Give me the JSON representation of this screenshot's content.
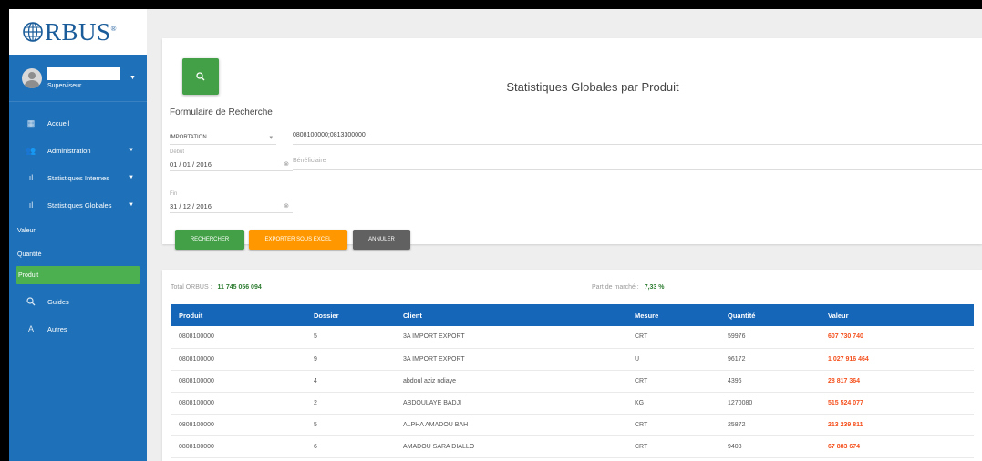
{
  "app": {
    "logo": "RBUS",
    "logo_mark": "®"
  },
  "user": {
    "role": "Superviseur"
  },
  "sidebar": {
    "items": [
      {
        "label": "Accueil"
      },
      {
        "label": "Administration"
      },
      {
        "label": "Statistiques Internes"
      },
      {
        "label": "Statistiques Globales"
      }
    ],
    "subitems": [
      {
        "label": "Valeur"
      },
      {
        "label": "Quantité"
      },
      {
        "label": "Produit"
      }
    ],
    "bottom": [
      {
        "label": "Guides"
      },
      {
        "label": "Autres"
      }
    ]
  },
  "page": {
    "title": "Statistiques Globales par Produit",
    "form_title": "Formulaire de Recherche"
  },
  "form": {
    "type_value": "IMPORTATION",
    "produit_value": "0808100000;0813300000",
    "debut_label": "Début",
    "debut_value": "01 / 01 / 2016",
    "beneficiaire_placeholder": "Bénéficiaire",
    "fin_label": "Fin",
    "fin_value": "31 / 12 / 2016"
  },
  "buttons": {
    "rechercher": "RECHERCHER",
    "exporter": "EXPORTER SOUS EXCEL",
    "annuler": "ANNULER"
  },
  "summary": {
    "total_label": "Total ORBUS :",
    "total_value": "11 745 056 094",
    "part_label": "Part de marché :",
    "part_value": "7,33 %"
  },
  "table": {
    "headers": [
      "Produit",
      "Dossier",
      "Client",
      "Mesure",
      "Quantité",
      "Valeur"
    ],
    "rows": [
      [
        "0808100000",
        "5",
        "3A IMPORT EXPORT",
        "CRT",
        "59976",
        "607 730 740"
      ],
      [
        "0808100000",
        "9",
        "3A IMPORT EXPORT",
        "U",
        "96172",
        "1 027 916 464"
      ],
      [
        "0808100000",
        "4",
        "abdoul aziz ndiaye",
        "CRT",
        "4396",
        "28 817 364"
      ],
      [
        "0808100000",
        "2",
        "ABDOULAYE BADJI",
        "KG",
        "1270080",
        "515 524 077"
      ],
      [
        "0808100000",
        "5",
        "ALPHA AMADOU BAH",
        "CRT",
        "25872",
        "213 239 811"
      ],
      [
        "0808100000",
        "6",
        "AMADOU SARA DIALLO",
        "CRT",
        "9408",
        "67 883 674"
      ]
    ]
  },
  "colors": {
    "sidebar": "#1e70b8",
    "active": "#4caf50",
    "table_header": "#1565b8",
    "value": "#f4511e",
    "green": "#43a047",
    "orange": "#ff9800"
  }
}
